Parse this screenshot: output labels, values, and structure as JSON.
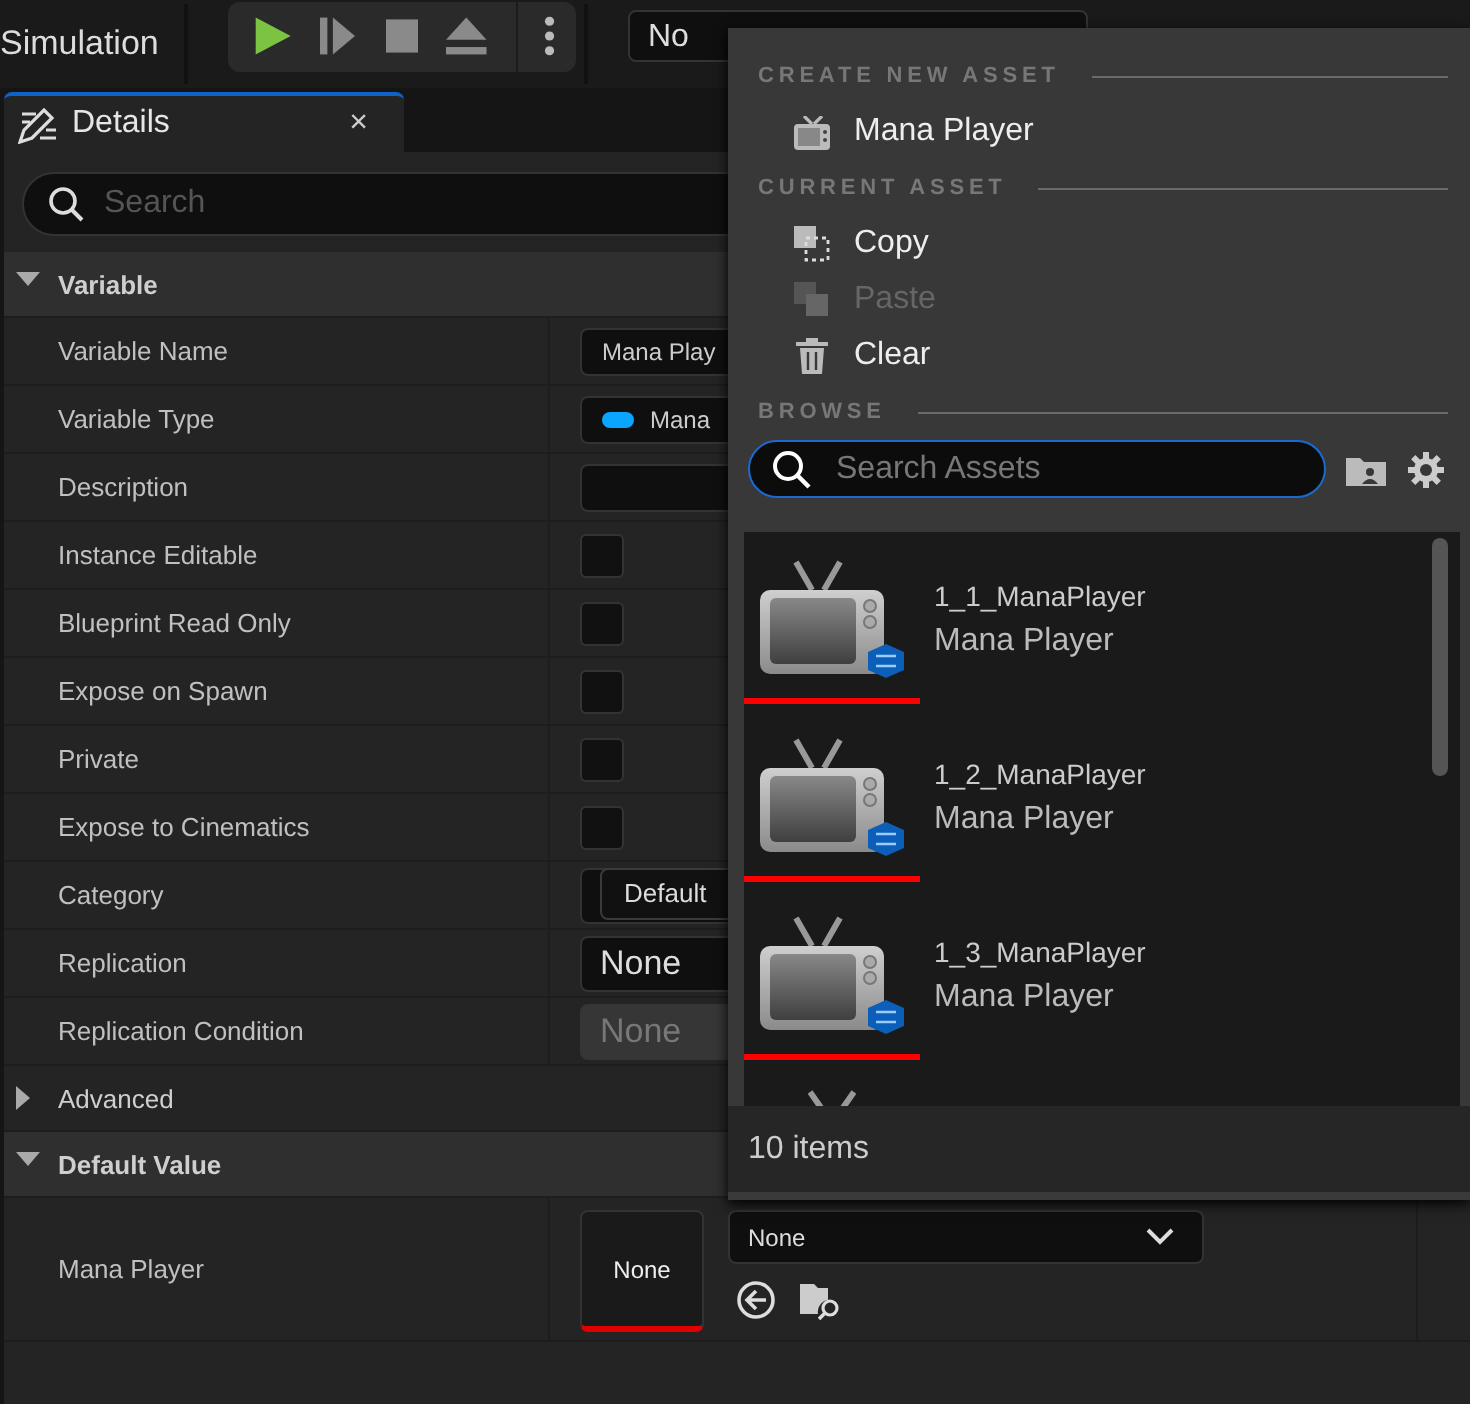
{
  "toolbar": {
    "mode_label": "Simulation",
    "debug_selector": "No"
  },
  "details_tab": {
    "title": "Details",
    "close": "×",
    "search_placeholder": "Search"
  },
  "categories": [
    {
      "title": "Variable",
      "expanded": true,
      "rows": [
        {
          "label": "Variable Name",
          "kind": "text",
          "value": "Mana Play"
        },
        {
          "label": "Variable Type",
          "kind": "type",
          "value": "Mana",
          "color": "#0aa5ff"
        },
        {
          "label": "Description",
          "kind": "text"
        },
        {
          "label": "Instance Editable",
          "kind": "checkbox",
          "checked": false
        },
        {
          "label": "Blueprint Read Only",
          "kind": "checkbox",
          "checked": false
        },
        {
          "label": "Expose on Spawn",
          "kind": "checkbox",
          "checked": false
        },
        {
          "label": "Private",
          "kind": "checkbox",
          "checked": false
        },
        {
          "label": "Expose to Cinematics",
          "kind": "checkbox",
          "checked": false
        },
        {
          "label": "Category",
          "kind": "category",
          "value": "Default"
        },
        {
          "label": "Replication",
          "kind": "combo",
          "value": "None",
          "disabled": false
        },
        {
          "label": "Replication Condition",
          "kind": "combo",
          "value": "None",
          "disabled": true
        }
      ]
    },
    {
      "title": "Advanced",
      "expanded": false
    },
    {
      "title": "Default Value",
      "expanded": true,
      "rows": [
        {
          "label": "Mana Player",
          "kind": "asset",
          "thumbnail": "None",
          "value": "None"
        }
      ]
    }
  ],
  "picker": {
    "sections": [
      {
        "heading": "CREATE NEW ASSET",
        "items": [
          {
            "label": "Mana Player",
            "disabled": false
          }
        ]
      },
      {
        "heading": "CURRENT ASSET",
        "items": [
          {
            "label": "Copy",
            "disabled": false
          },
          {
            "label": "Paste",
            "disabled": true
          },
          {
            "label": "Clear",
            "disabled": false
          }
        ]
      },
      {
        "heading": "BROWSE"
      }
    ],
    "search_placeholder": "Search Assets",
    "assets": [
      {
        "name": "1_1_ManaPlayer",
        "type": "Mana Player"
      },
      {
        "name": "1_2_ManaPlayer",
        "type": "Mana Player"
      },
      {
        "name": "1_3_ManaPlayer",
        "type": "Mana Player"
      }
    ],
    "count": "10 items"
  }
}
